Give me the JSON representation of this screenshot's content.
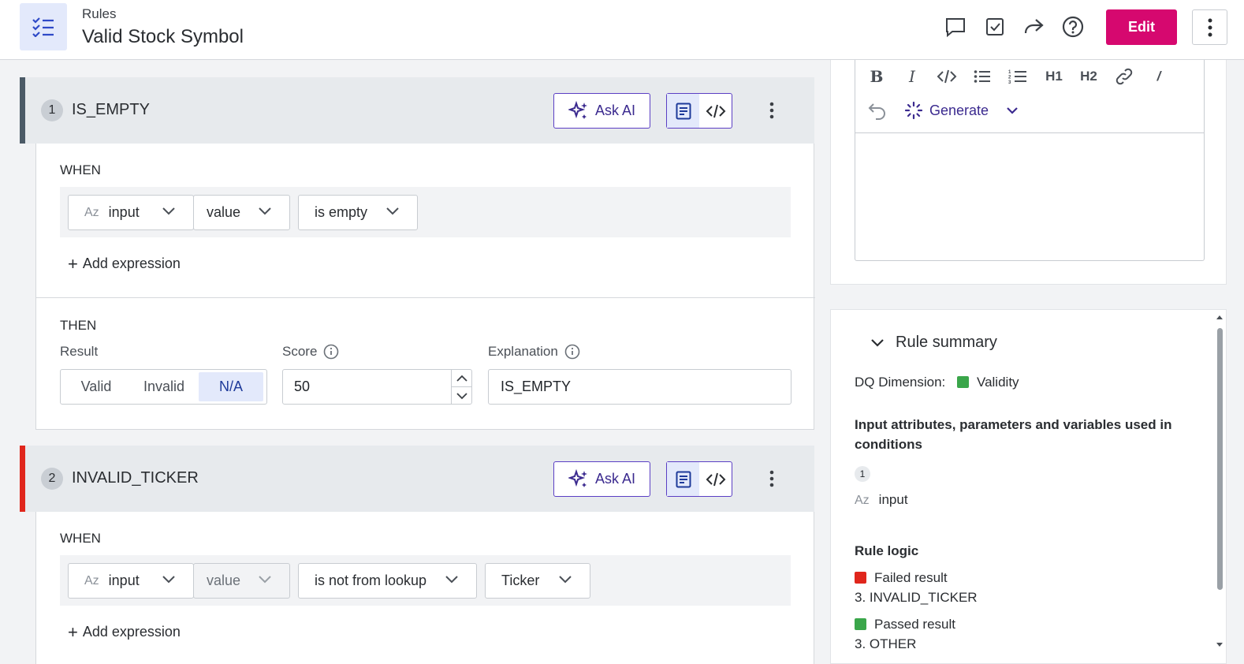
{
  "header": {
    "breadcrumb": "Rules",
    "title": "Valid Stock Symbol",
    "edit_label": "Edit",
    "icons": [
      "rules-list-icon",
      "comment-icon",
      "task-check-icon",
      "share-icon",
      "help-icon",
      "more-vertical-icon"
    ]
  },
  "colors": {
    "accent": "#d6086f",
    "primary": "#5b3fc4",
    "rule1_bar": "#4b5a66",
    "rule2_bar": "#e0261c",
    "valid": "#3aa64a",
    "failed": "#e0261c"
  },
  "rules": [
    {
      "number": "1",
      "name": "IS_EMPTY",
      "ask_ai": "Ask AI",
      "when_label": "WHEN",
      "expression": {
        "input_prefix": "Az",
        "input": "input",
        "attribute": "value",
        "operator": "is empty"
      },
      "add_expression": "Add expression",
      "then_label": "THEN",
      "result_label": "Result",
      "result_options": [
        "Valid",
        "Invalid",
        "N/A"
      ],
      "result_selected": "N/A",
      "score_label": "Score",
      "score_value": "50",
      "explanation_label": "Explanation",
      "explanation_value": "IS_EMPTY"
    },
    {
      "number": "2",
      "name": "INVALID_TICKER",
      "ask_ai": "Ask AI",
      "when_label": "WHEN",
      "expression": {
        "input_prefix": "Az",
        "input": "input",
        "attribute": "value",
        "operator": "is not from lookup",
        "lookup": "Ticker"
      },
      "add_expression": "Add expression"
    }
  ],
  "editor": {
    "toolbar": [
      "B",
      "I",
      "</>",
      "bullet-list-icon",
      "numbered-list-icon",
      "H1",
      "H2",
      "link-icon",
      "/"
    ],
    "undo_icon": "undo-icon",
    "generate_label": "Generate"
  },
  "summary": {
    "title": "Rule summary",
    "dq_dimension_label": "DQ Dimension:",
    "dq_dimension_value": "Validity",
    "inputs_heading": "Input attributes, parameters and variables used in conditions",
    "inputs_count": "1",
    "input_prefix": "Az",
    "input_name": "input",
    "logic_heading": "Rule logic",
    "failed_label": "Failed result",
    "failed_value": "3. INVALID_TICKER",
    "passed_label": "Passed result",
    "passed_value": "3. OTHER"
  }
}
